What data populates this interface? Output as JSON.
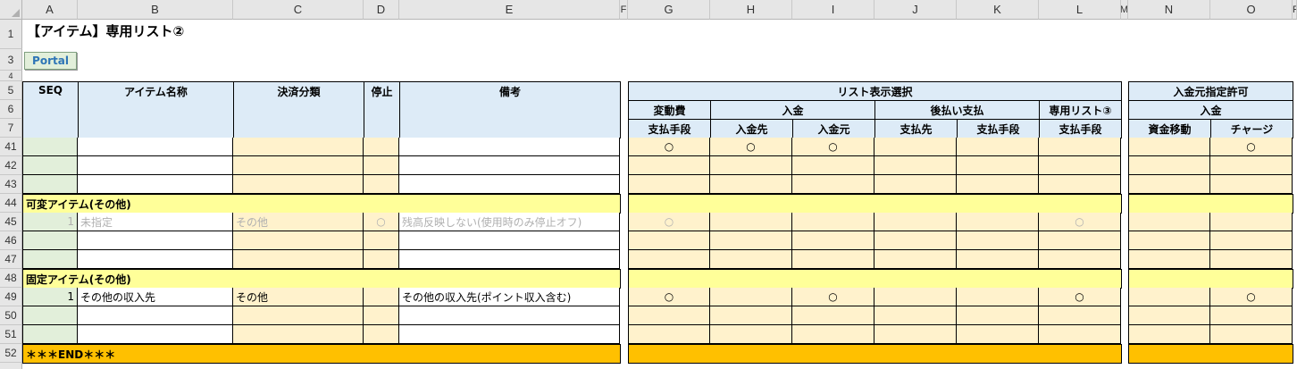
{
  "sheet": {
    "title": "【アイテム】専用リスト②",
    "portal_label": "Portal",
    "columns": [
      "A",
      "B",
      "C",
      "D",
      "E",
      "F",
      "G",
      "H",
      "I",
      "J",
      "K",
      "L",
      "M",
      "N",
      "O",
      "P"
    ],
    "row_numbers": [
      "1",
      "3",
      "4",
      "5",
      "6",
      "7",
      "41",
      "42",
      "43",
      "44",
      "45",
      "46",
      "47",
      "48",
      "49",
      "50",
      "51",
      "52"
    ]
  },
  "header": {
    "seq": "SEQ",
    "item_name": "アイテム名称",
    "settlement": "決済分類",
    "stop": "停止",
    "remarks": "備考",
    "list_display": "リスト表示選択",
    "variable_cost": "変動費",
    "deposit": "入金",
    "postpay": "後払い支払",
    "dedicated_list": "専用リスト③",
    "payment_method": "支払手段",
    "deposit_to": "入金先",
    "deposit_from": "入金元",
    "payee": "支払先",
    "deposit_source_perm": "入金元指定許可",
    "fund_move": "資金移動",
    "charge": "チャージ"
  },
  "sections": {
    "variable_other": "可変アイテム(その他)",
    "fixed_other": "固定アイテム(その他)",
    "end": "＊＊＊END＊＊＊"
  },
  "rows": {
    "r41": {
      "G": "○",
      "H": "○",
      "I": "○",
      "O": "○"
    },
    "r45": {
      "A": "1",
      "B": "未指定",
      "C": "その他",
      "D": "○",
      "E": "残高反映しない(使用時のみ停止オフ)",
      "G": "○",
      "L": "○"
    },
    "r49": {
      "A": "1",
      "B": "その他の収入先",
      "C": "その他",
      "E": "その他の収入先(ポイント収入含む)",
      "G": "○",
      "I": "○",
      "L": "○",
      "O": "○"
    }
  },
  "colors": {
    "header_blue": "#ddebf7",
    "seq_green": "#e2efda",
    "beige": "#fff2cc",
    "section_yellow": "#ffff99",
    "end_orange": "#ffc000"
  }
}
